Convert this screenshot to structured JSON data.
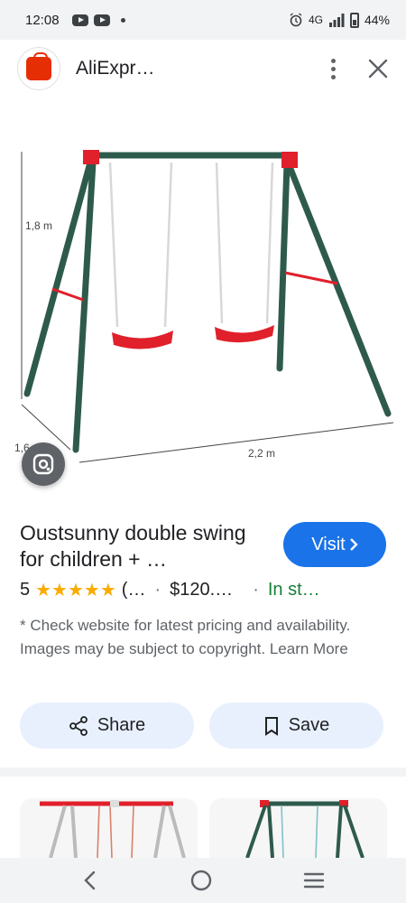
{
  "status_bar": {
    "time": "12:08",
    "network": "4G",
    "battery": "44%",
    "icons": [
      "youtube-icon",
      "youtube-icon",
      "notification-dot-icon",
      "alarm-icon",
      "signal-icon",
      "battery-icon"
    ]
  },
  "header": {
    "app_title": "AliExpr…",
    "logo_icon": "aliexpress-logo-icon",
    "menu_icon": "more-vert-icon",
    "close_icon": "close-icon"
  },
  "image": {
    "height_label": "1,8 m",
    "depth_label": "1,6 m",
    "width_label": "2,2 m"
  },
  "product": {
    "title": "Oustsunny double swing for children + …",
    "visit_label": "Visit",
    "rating": "5",
    "stars": "★★★★★",
    "reviews": "(…",
    "price": "$120.…",
    "availability": "In st…",
    "disclaimer": "* Check website for latest pricing and availability. Images may be subject to copyright. Learn More"
  },
  "actions": {
    "share_label": "Share",
    "save_label": "Save"
  },
  "colors": {
    "accent": "#1a73e8",
    "star": "#f9ab00",
    "in_stock": "#188038",
    "chip_bg": "#e8f0fe",
    "swing_frame": "#2e5a4c",
    "swing_seat": "#e0202a"
  }
}
